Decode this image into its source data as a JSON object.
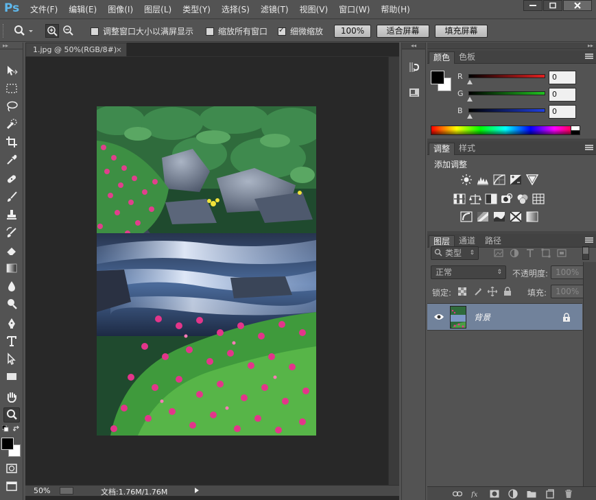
{
  "app": {
    "logo": "Ps",
    "menu": [
      "文件(F)",
      "编辑(E)",
      "图像(I)",
      "图层(L)",
      "类型(Y)",
      "选择(S)",
      "滤镜(T)",
      "视图(V)",
      "窗口(W)",
      "帮助(H)"
    ]
  },
  "options_bar": {
    "resize_windows_label": "调整窗口大小以满屏显示",
    "resize_windows_checked": false,
    "zoom_all_label": "缩放所有窗口",
    "zoom_all_checked": false,
    "scrubby_zoom_label": "细微缩放",
    "scrubby_zoom_checked": true,
    "btn_100": "100%",
    "btn_fit": "适合屏幕",
    "btn_fill": "填充屏幕"
  },
  "document": {
    "tab_title": "1.jpg @ 50%(RGB/8#)",
    "close_glyph": "×",
    "zoom": "50%",
    "doc_info": "文档:1.76M/1.76M"
  },
  "color_panel": {
    "tabs": [
      "颜色",
      "色板"
    ],
    "channels": [
      {
        "label": "R",
        "value": "0",
        "color": "#e32020"
      },
      {
        "label": "G",
        "value": "0",
        "color": "#20c020"
      },
      {
        "label": "B",
        "value": "0",
        "color": "#2040e0"
      }
    ],
    "foreground": "#000000",
    "background": "#ffffff"
  },
  "adjustments_panel": {
    "tabs": [
      "调整",
      "样式"
    ],
    "title": "添加调整"
  },
  "layers_panel": {
    "tabs": [
      "图层",
      "通道",
      "路径"
    ],
    "filter_kind": "类型",
    "blend_mode": "正常",
    "opacity_label": "不透明度:",
    "opacity_value": "100%",
    "lock_label": "锁定:",
    "fill_label": "填充:",
    "fill_value": "100%",
    "layer_name": "背景"
  },
  "colors": {
    "ui_bg": "#535353",
    "canvas_bg": "#282828",
    "selected_layer": "#71829b",
    "logo_blue": "#5fb8ec"
  }
}
